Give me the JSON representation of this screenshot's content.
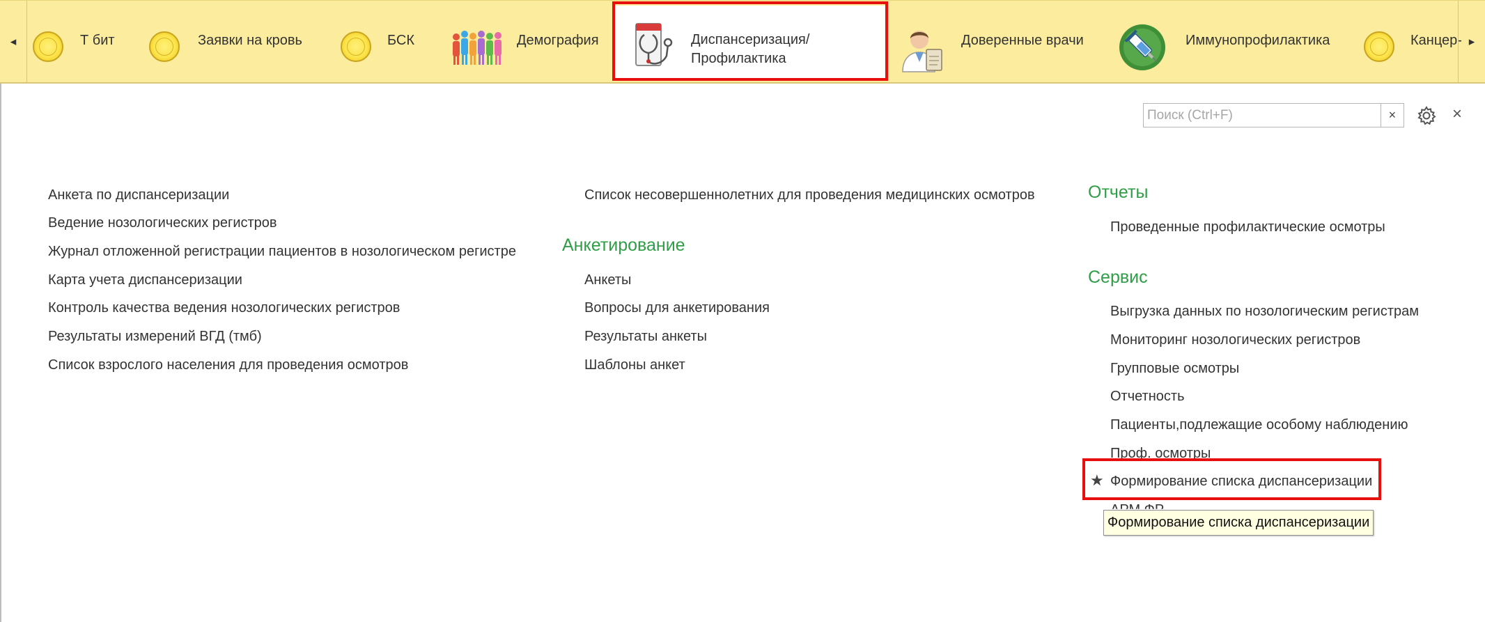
{
  "topbar": {
    "tabs": [
      {
        "label": "Т бит",
        "icon": "coin-icon"
      },
      {
        "label": "Заявки на кровь",
        "icon": "coin-icon"
      },
      {
        "label": "БСК",
        "icon": "coin-icon"
      },
      {
        "label": "Демография",
        "icon": "people-icon"
      },
      {
        "label": "Диспансеризация/Профилактика",
        "icon": "stethoscope-icon",
        "active": true
      },
      {
        "label": "Доверенные врачи",
        "icon": "doctor-icon"
      },
      {
        "label": "Иммунопрофилактика",
        "icon": "syringe-icon"
      },
      {
        "label": "Канцер-",
        "icon": "coin-icon"
      }
    ],
    "scroll_left": "◂",
    "scroll_right": "▸"
  },
  "toolbar": {
    "search_placeholder": "Поиск (Ctrl+F)",
    "search_value": "",
    "clear_label": "×",
    "close_label": "×"
  },
  "columns": {
    "col1": {
      "items": [
        "Анкета по диспансеризации",
        "Ведение нозологических регистров",
        "Журнал отложенной регистрации пациентов в нозологическом регистре",
        "Карта учета диспансеризации",
        "Контроль качества ведения нозологических регистров",
        "Результаты измерений ВГД (тмб)",
        "Список взрослого населения для проведения осмотров"
      ]
    },
    "col2": {
      "top_items": [
        "Список несовершеннолетних для проведения медицинских осмотров"
      ],
      "group_title": "Анкетирование",
      "group_items": [
        "Анкеты",
        "Вопросы для анкетирования",
        "Результаты анкеты",
        "Шаблоны анкет"
      ]
    },
    "col3": {
      "reports_title": "Отчеты",
      "reports_items": [
        "Проведенные профилактические осмотры"
      ],
      "service_title": "Сервис",
      "service_items": [
        "Выгрузка данных по нозологическим регистрам",
        "Мониторинг нозологических регистров",
        "Групповые осмотры",
        "Отчетность",
        "Пациенты,подлежащие особому наблюдению",
        "Проф. осмотры",
        "Формирование списка диспансеризации",
        "АРМ ФР"
      ]
    }
  },
  "favorite_star": "★",
  "tooltip": "Формирование списка диспансеризации",
  "colors": {
    "topbar_bg": "#fbec9e",
    "group_title": "#2f9e46",
    "highlight": "#e8100e",
    "tooltip_bg": "#ffffe1"
  }
}
